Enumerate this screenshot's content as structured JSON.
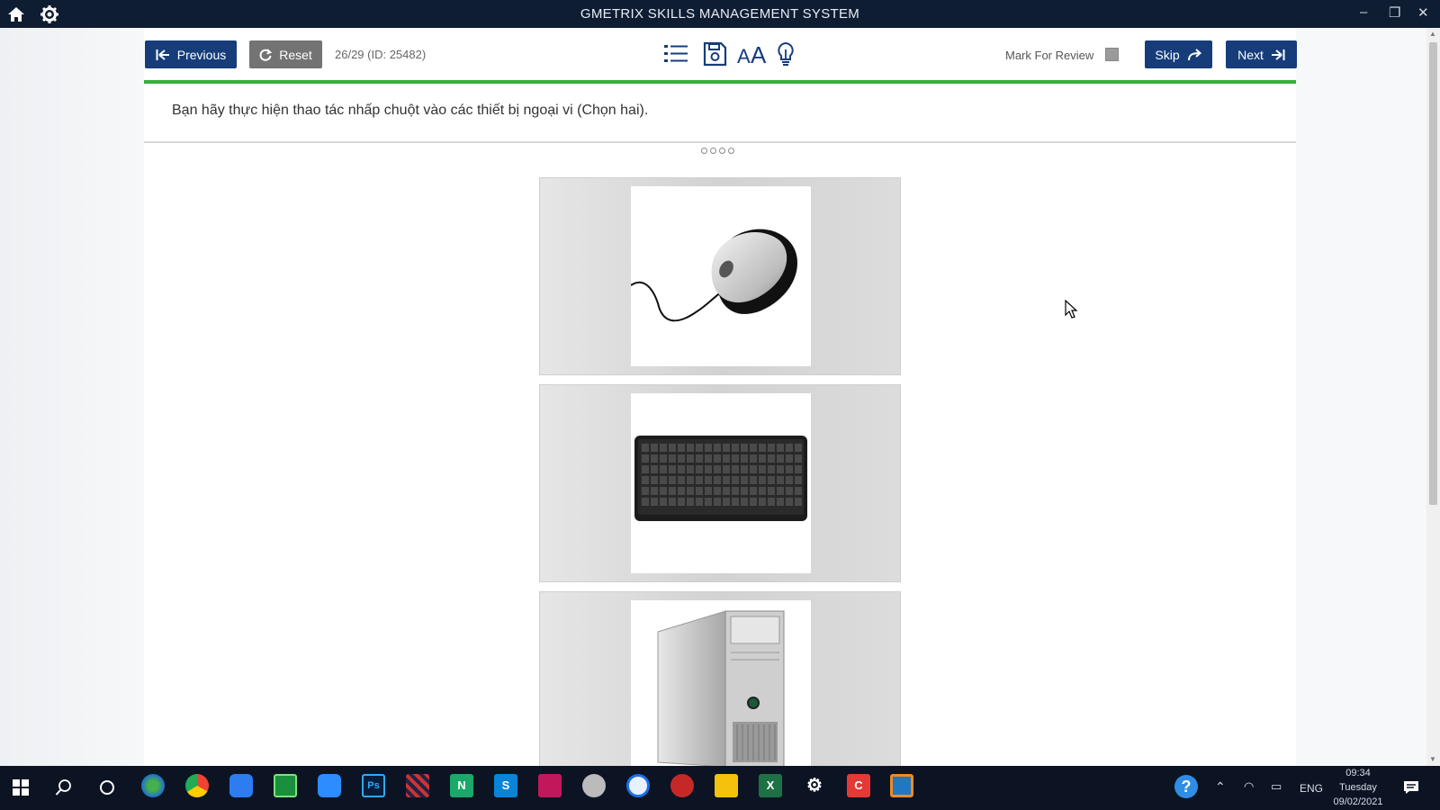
{
  "app": {
    "title": "GMETRIX SKILLS MANAGEMENT SYSTEM"
  },
  "toolbar": {
    "previous_label": "Previous",
    "reset_label": "Reset",
    "counter": "26/29 (ID: 25482)",
    "mark_for_review_label": "Mark For Review",
    "skip_label": "Skip",
    "next_label": "Next"
  },
  "question": {
    "text": "Bạn hãy thực hiện thao tác nhấp chuột vào các thiết bị ngoại vi (Chọn hai)."
  },
  "answers": [
    {
      "image": "computer-mouse"
    },
    {
      "image": "keyboard"
    },
    {
      "image": "desktop-tower"
    }
  ],
  "tray": {
    "language": "ENG",
    "time": "09:34",
    "day": "Tuesday",
    "date": "09/02/2021"
  },
  "colors": {
    "titlebar": "#0f1d33",
    "primary_button": "#163d7a",
    "reset_button": "#737373",
    "progress_rule": "#34b03a"
  }
}
